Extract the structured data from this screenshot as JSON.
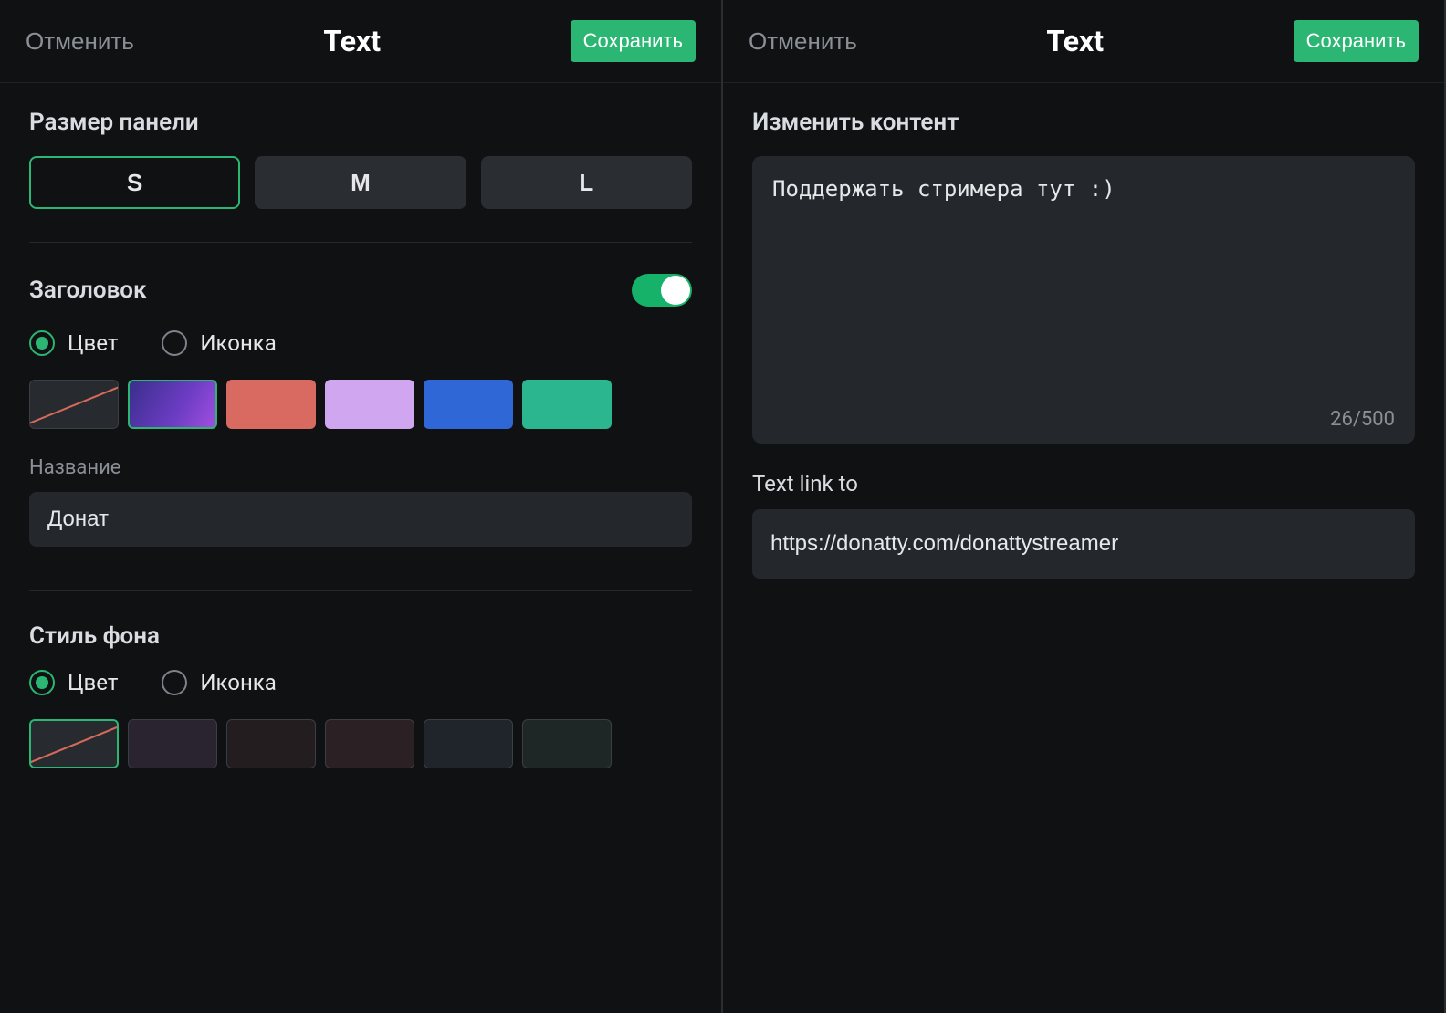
{
  "left": {
    "cancel": "Отменить",
    "title": "Text",
    "save": "Сохранить",
    "panelSize": {
      "label": "Размер панели",
      "options": [
        "S",
        "M",
        "L"
      ],
      "selected": "S"
    },
    "header": {
      "label": "Заголовок",
      "enabled": true,
      "radios": {
        "color": "Цвет",
        "icon": "Иконка",
        "selected": "color"
      },
      "swatches": [
        "none",
        "purple-grad",
        "red",
        "lav",
        "blue",
        "green"
      ],
      "selectedSwatch": 1,
      "nameLabel": "Название",
      "nameValue": "Донат"
    },
    "bg": {
      "label": "Стиль фона",
      "radios": {
        "color": "Цвет",
        "icon": "Иконка",
        "selected": "color"
      },
      "swatches": [
        "none",
        "dark1",
        "dark2",
        "dark3",
        "dark4",
        "dark5"
      ],
      "selectedSwatch": 0
    }
  },
  "right": {
    "cancel": "Отменить",
    "title": "Text",
    "save": "Сохранить",
    "contentLabel": "Изменить контент",
    "contentValue": "Поддержать стримера тут :)",
    "counter": "26/500",
    "linkLabel": "Text link to",
    "linkValue": "https://donatty.com/donattystreamer"
  }
}
